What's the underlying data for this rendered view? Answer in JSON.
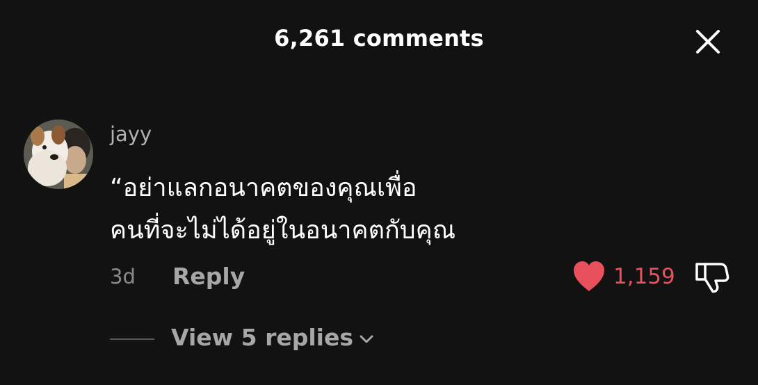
{
  "header": {
    "title": "6,261 comments",
    "close_icon": "close-icon"
  },
  "comment": {
    "avatar_icon": "user-avatar",
    "username": "jayy",
    "text_lines": [
      "“อย่าแลกอนาคตของคุณเพื่อ",
      "คนที่จะไม่ได้อยู่ในอนาคตกับคุณ"
    ],
    "timestamp": "3d",
    "reply_label": "Reply",
    "like_icon": "heart-icon",
    "like_count": "1,159",
    "dislike_icon": "thumbs-down-icon",
    "view_replies_label": "View 5 replies",
    "view_replies_icon": "chevron-down-icon"
  },
  "colors": {
    "background": "#121212",
    "like_red": "#e8505b",
    "secondary_text": "#a7a7a7",
    "username": "#b2b2b2"
  }
}
